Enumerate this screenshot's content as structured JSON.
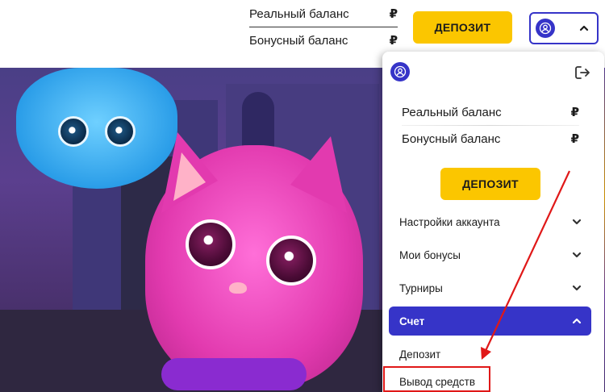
{
  "header": {
    "real_balance_label": "Реальный баланс",
    "bonus_balance_label": "Бонусный баланс",
    "currency_symbol": "₽",
    "deposit_button": "ДЕПОЗИТ"
  },
  "panel": {
    "real_balance_label": "Реальный баланс",
    "bonus_balance_label": "Бонусный баланс",
    "currency_symbol": "₽",
    "deposit_button": "ДЕПОЗИТ",
    "menu": [
      {
        "label": "Настройки аккаунта",
        "expanded": false
      },
      {
        "label": "Мои бонусы",
        "expanded": false
      },
      {
        "label": "Турниры",
        "expanded": false
      },
      {
        "label": "Счет",
        "expanded": true
      }
    ],
    "submenu": [
      {
        "label": "Депозит"
      },
      {
        "label": "Вывод средств"
      }
    ]
  },
  "colors": {
    "accent": "#3634c8",
    "deposit": "#fbc600",
    "annotation": "#e01818"
  },
  "icons": [
    "user-icon",
    "chevron-up-icon",
    "logout-icon",
    "chevron-down-icon"
  ]
}
